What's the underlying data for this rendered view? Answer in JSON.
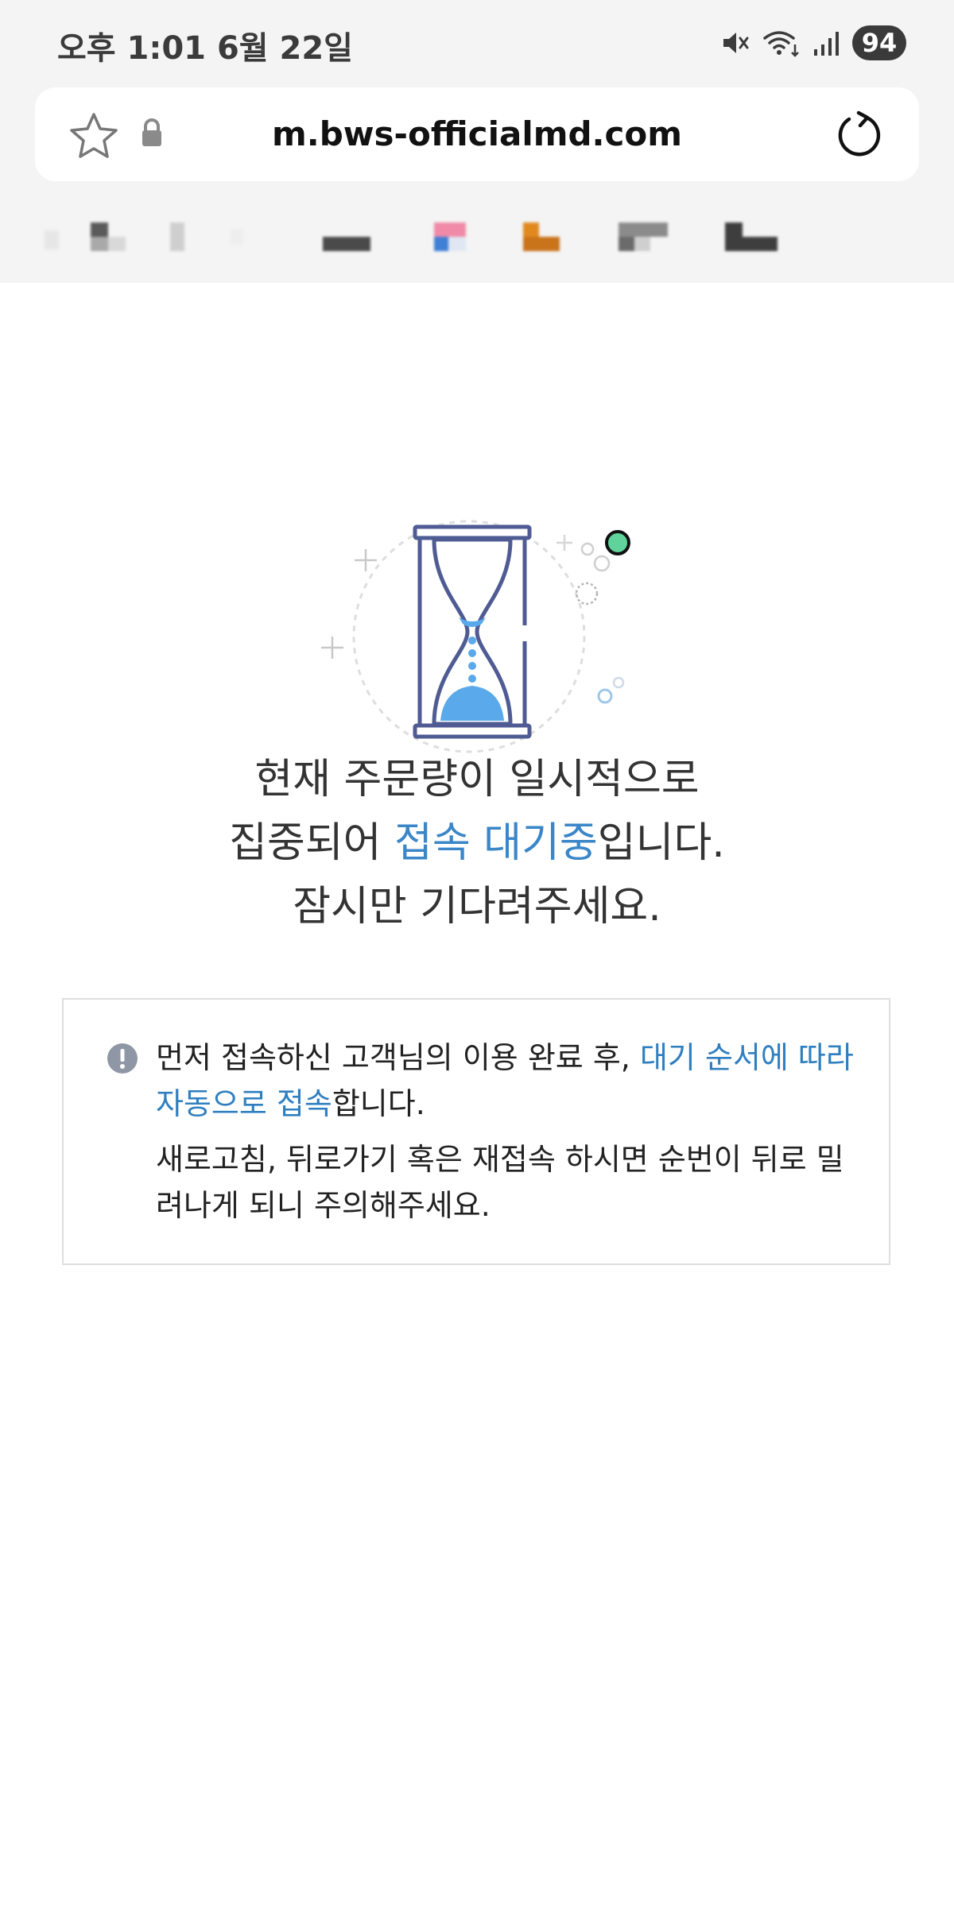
{
  "status_bar": {
    "time": "오후 1:01  6월 22일",
    "battery": "94"
  },
  "browser": {
    "url": "m.bws-officialmd.com"
  },
  "icons": {
    "bookmark": "star-icon",
    "secure": "lock-icon",
    "reload": "reload-icon",
    "mute": "mute-icon",
    "wifi": "wifi-icon",
    "signal": "signal-icon",
    "hourglass": "hourglass-icon",
    "notice": "exclamation-icon"
  },
  "colors": {
    "accent": "#3a86c8",
    "hourglass_frame": "#4f5b93",
    "sand": "#5aa9ea",
    "green_dot": "#5fd39b"
  },
  "headline": {
    "line1": "현재 주문량이 일시적으로",
    "line2_pre": "집중되어 ",
    "line2_hl": "접속 대기중",
    "line2_post": "입니다.",
    "line3": "잠시만 기다려주세요."
  },
  "notice": {
    "p1_pre": "먼저 접속하신 고객님의 이용 완료 후, ",
    "p1_hl": "대기 순서에 따라 자동으로 접속",
    "p1_post": "합니다.",
    "p2": "새로고침, 뒤로가기 혹은 재접속 하시면 순번이 뒤로 밀려나게 되니 주의해주세요."
  }
}
